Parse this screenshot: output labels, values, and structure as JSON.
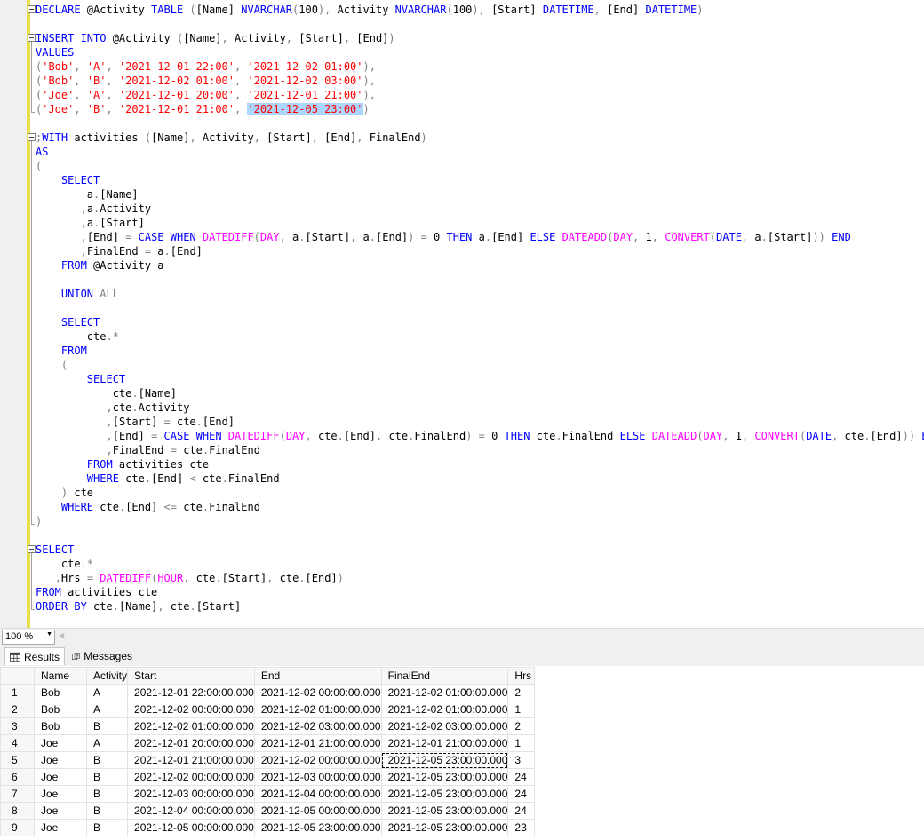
{
  "editor": {
    "lines": [
      [
        [
          "k",
          "DECLARE "
        ],
        [
          "t",
          "@Activity "
        ],
        [
          "k",
          "TABLE "
        ],
        [
          "g",
          "("
        ],
        [
          "t",
          "[Name] "
        ],
        [
          "k",
          "NVARCHAR"
        ],
        [
          "g",
          "("
        ],
        [
          "t",
          "100"
        ],
        [
          "g",
          "), "
        ],
        [
          "t",
          "Activity "
        ],
        [
          "k",
          "NVARCHAR"
        ],
        [
          "g",
          "("
        ],
        [
          "t",
          "100"
        ],
        [
          "g",
          "), "
        ],
        [
          "t",
          "[Start] "
        ],
        [
          "k",
          "DATETIME"
        ],
        [
          "g",
          ", "
        ],
        [
          "t",
          "[End] "
        ],
        [
          "k",
          "DATETIME"
        ],
        [
          "g",
          ")"
        ]
      ],
      [],
      [
        [
          "k",
          "INSERT INTO "
        ],
        [
          "t",
          "@Activity "
        ],
        [
          "g",
          "("
        ],
        [
          "t",
          "[Name]"
        ],
        [
          "g",
          ", "
        ],
        [
          "t",
          "Activity"
        ],
        [
          "g",
          ", "
        ],
        [
          "t",
          "[Start]"
        ],
        [
          "g",
          ", "
        ],
        [
          "t",
          "[End]"
        ],
        [
          "g",
          ")"
        ]
      ],
      [
        [
          "k",
          "VALUES"
        ]
      ],
      [
        [
          "g",
          "("
        ],
        [
          "s",
          "'Bob'"
        ],
        [
          "g",
          ", "
        ],
        [
          "s",
          "'A'"
        ],
        [
          "g",
          ", "
        ],
        [
          "s",
          "'2021-12-01 22:00'"
        ],
        [
          "g",
          ", "
        ],
        [
          "s",
          "'2021-12-02 01:00'"
        ],
        [
          "g",
          "),"
        ]
      ],
      [
        [
          "g",
          "("
        ],
        [
          "s",
          "'Bob'"
        ],
        [
          "g",
          ", "
        ],
        [
          "s",
          "'B'"
        ],
        [
          "g",
          ", "
        ],
        [
          "s",
          "'2021-12-02 01:00'"
        ],
        [
          "g",
          ", "
        ],
        [
          "s",
          "'2021-12-02 03:00'"
        ],
        [
          "g",
          "),"
        ]
      ],
      [
        [
          "g",
          "("
        ],
        [
          "s",
          "'Joe'"
        ],
        [
          "g",
          ", "
        ],
        [
          "s",
          "'A'"
        ],
        [
          "g",
          ", "
        ],
        [
          "s",
          "'2021-12-01 20:00'"
        ],
        [
          "g",
          ", "
        ],
        [
          "s",
          "'2021-12-01 21:00'"
        ],
        [
          "g",
          "),"
        ]
      ],
      [
        [
          "g",
          "("
        ],
        [
          "s",
          "'Joe'"
        ],
        [
          "g",
          ", "
        ],
        [
          "s",
          "'B'"
        ],
        [
          "g",
          ", "
        ],
        [
          "s",
          "'2021-12-01 21:00'"
        ],
        [
          "g",
          ", "
        ],
        [
          "sel",
          "'2021-12-05 23:00'"
        ],
        [
          "g",
          ")"
        ]
      ],
      [],
      [
        [
          "g",
          ";"
        ],
        [
          "k",
          "WITH "
        ],
        [
          "t",
          "activities "
        ],
        [
          "g",
          "("
        ],
        [
          "t",
          "[Name]"
        ],
        [
          "g",
          ", "
        ],
        [
          "t",
          "Activity"
        ],
        [
          "g",
          ", "
        ],
        [
          "t",
          "[Start]"
        ],
        [
          "g",
          ", "
        ],
        [
          "t",
          "[End]"
        ],
        [
          "g",
          ", "
        ],
        [
          "t",
          "FinalEnd"
        ],
        [
          "g",
          ")"
        ]
      ],
      [
        [
          "k",
          "AS"
        ]
      ],
      [
        [
          "g",
          "("
        ]
      ],
      [
        [
          "t",
          "    "
        ],
        [
          "k",
          "SELECT"
        ]
      ],
      [
        [
          "t",
          "        a"
        ],
        [
          "g",
          "."
        ],
        [
          "t",
          "[Name]"
        ]
      ],
      [
        [
          "t",
          "       "
        ],
        [
          "g",
          ","
        ],
        [
          "t",
          "a"
        ],
        [
          "g",
          "."
        ],
        [
          "t",
          "Activity"
        ]
      ],
      [
        [
          "t",
          "       "
        ],
        [
          "g",
          ","
        ],
        [
          "t",
          "a"
        ],
        [
          "g",
          "."
        ],
        [
          "t",
          "[Start]"
        ]
      ],
      [
        [
          "t",
          "       "
        ],
        [
          "g",
          ","
        ],
        [
          "t",
          "[End] "
        ],
        [
          "g",
          "= "
        ],
        [
          "k",
          "CASE WHEN "
        ],
        [
          "f",
          "DATEDIFF"
        ],
        [
          "g",
          "("
        ],
        [
          "f",
          "DAY"
        ],
        [
          "g",
          ", "
        ],
        [
          "t",
          "a"
        ],
        [
          "g",
          "."
        ],
        [
          "t",
          "[Start]"
        ],
        [
          "g",
          ", "
        ],
        [
          "t",
          "a"
        ],
        [
          "g",
          "."
        ],
        [
          "t",
          "[End]"
        ],
        [
          "g",
          ") = "
        ],
        [
          "t",
          "0 "
        ],
        [
          "k",
          "THEN "
        ],
        [
          "t",
          "a"
        ],
        [
          "g",
          "."
        ],
        [
          "t",
          "[End] "
        ],
        [
          "k",
          "ELSE "
        ],
        [
          "f",
          "DATEADD"
        ],
        [
          "g",
          "("
        ],
        [
          "f",
          "DAY"
        ],
        [
          "g",
          ", "
        ],
        [
          "t",
          "1"
        ],
        [
          "g",
          ", "
        ],
        [
          "f",
          "CONVERT"
        ],
        [
          "g",
          "("
        ],
        [
          "k",
          "DATE"
        ],
        [
          "g",
          ", "
        ],
        [
          "t",
          "a"
        ],
        [
          "g",
          "."
        ],
        [
          "t",
          "[Start]"
        ],
        [
          "g",
          "))"
        ],
        [
          "t",
          " "
        ],
        [
          "k",
          "END"
        ]
      ],
      [
        [
          "t",
          "       "
        ],
        [
          "g",
          ","
        ],
        [
          "t",
          "FinalEnd "
        ],
        [
          "g",
          "= "
        ],
        [
          "t",
          "a"
        ],
        [
          "g",
          "."
        ],
        [
          "t",
          "[End]"
        ]
      ],
      [
        [
          "t",
          "    "
        ],
        [
          "k",
          "FROM "
        ],
        [
          "t",
          "@Activity a"
        ]
      ],
      [],
      [
        [
          "t",
          "    "
        ],
        [
          "k",
          "UNION "
        ],
        [
          "g",
          "ALL"
        ]
      ],
      [],
      [
        [
          "t",
          "    "
        ],
        [
          "k",
          "SELECT"
        ]
      ],
      [
        [
          "t",
          "        cte"
        ],
        [
          "g",
          ".*"
        ]
      ],
      [
        [
          "t",
          "    "
        ],
        [
          "k",
          "FROM"
        ]
      ],
      [
        [
          "t",
          "    "
        ],
        [
          "g",
          "("
        ]
      ],
      [
        [
          "t",
          "        "
        ],
        [
          "k",
          "SELECT"
        ]
      ],
      [
        [
          "t",
          "            cte"
        ],
        [
          "g",
          "."
        ],
        [
          "t",
          "[Name]"
        ]
      ],
      [
        [
          "t",
          "           "
        ],
        [
          "g",
          ","
        ],
        [
          "t",
          "cte"
        ],
        [
          "g",
          "."
        ],
        [
          "t",
          "Activity"
        ]
      ],
      [
        [
          "t",
          "           "
        ],
        [
          "g",
          ","
        ],
        [
          "t",
          "[Start] "
        ],
        [
          "g",
          "= "
        ],
        [
          "t",
          "cte"
        ],
        [
          "g",
          "."
        ],
        [
          "t",
          "[End]"
        ]
      ],
      [
        [
          "t",
          "           "
        ],
        [
          "g",
          ","
        ],
        [
          "t",
          "[End] "
        ],
        [
          "g",
          "= "
        ],
        [
          "k",
          "CASE WHEN "
        ],
        [
          "f",
          "DATEDIFF"
        ],
        [
          "g",
          "("
        ],
        [
          "f",
          "DAY"
        ],
        [
          "g",
          ", "
        ],
        [
          "t",
          "cte"
        ],
        [
          "g",
          "."
        ],
        [
          "t",
          "[End]"
        ],
        [
          "g",
          ", "
        ],
        [
          "t",
          "cte"
        ],
        [
          "g",
          "."
        ],
        [
          "t",
          "FinalEnd"
        ],
        [
          "g",
          ") = "
        ],
        [
          "t",
          "0 "
        ],
        [
          "k",
          "THEN "
        ],
        [
          "t",
          "cte"
        ],
        [
          "g",
          "."
        ],
        [
          "t",
          "FinalEnd "
        ],
        [
          "k",
          "ELSE "
        ],
        [
          "f",
          "DATEADD"
        ],
        [
          "g",
          "("
        ],
        [
          "f",
          "DAY"
        ],
        [
          "g",
          ", "
        ],
        [
          "t",
          "1"
        ],
        [
          "g",
          ", "
        ],
        [
          "f",
          "CONVERT"
        ],
        [
          "g",
          "("
        ],
        [
          "k",
          "DATE"
        ],
        [
          "g",
          ", "
        ],
        [
          "t",
          "cte"
        ],
        [
          "g",
          "."
        ],
        [
          "t",
          "[End]"
        ],
        [
          "g",
          "))"
        ],
        [
          "t",
          " "
        ],
        [
          "k",
          "END"
        ]
      ],
      [
        [
          "t",
          "           "
        ],
        [
          "g",
          ","
        ],
        [
          "t",
          "FinalEnd "
        ],
        [
          "g",
          "= "
        ],
        [
          "t",
          "cte"
        ],
        [
          "g",
          "."
        ],
        [
          "t",
          "FinalEnd"
        ]
      ],
      [
        [
          "t",
          "        "
        ],
        [
          "k",
          "FROM "
        ],
        [
          "t",
          "activities cte"
        ]
      ],
      [
        [
          "t",
          "        "
        ],
        [
          "k",
          "WHERE "
        ],
        [
          "t",
          "cte"
        ],
        [
          "g",
          "."
        ],
        [
          "t",
          "[End] "
        ],
        [
          "g",
          "< "
        ],
        [
          "t",
          "cte"
        ],
        [
          "g",
          "."
        ],
        [
          "t",
          "FinalEnd"
        ]
      ],
      [
        [
          "t",
          "    "
        ],
        [
          "g",
          ") "
        ],
        [
          "t",
          "cte"
        ]
      ],
      [
        [
          "t",
          "    "
        ],
        [
          "k",
          "WHERE "
        ],
        [
          "t",
          "cte"
        ],
        [
          "g",
          "."
        ],
        [
          "t",
          "[End] "
        ],
        [
          "g",
          "<= "
        ],
        [
          "t",
          "cte"
        ],
        [
          "g",
          "."
        ],
        [
          "t",
          "FinalEnd"
        ]
      ],
      [
        [
          "g",
          ")"
        ]
      ],
      [],
      [
        [
          "k",
          "SELECT"
        ]
      ],
      [
        [
          "t",
          "    cte"
        ],
        [
          "g",
          ".*"
        ]
      ],
      [
        [
          "t",
          "   "
        ],
        [
          "g",
          ","
        ],
        [
          "t",
          "Hrs "
        ],
        [
          "g",
          "= "
        ],
        [
          "f",
          "DATEDIFF"
        ],
        [
          "g",
          "("
        ],
        [
          "f",
          "HOUR"
        ],
        [
          "g",
          ", "
        ],
        [
          "t",
          "cte"
        ],
        [
          "g",
          "."
        ],
        [
          "t",
          "[Start]"
        ],
        [
          "g",
          ", "
        ],
        [
          "t",
          "cte"
        ],
        [
          "g",
          "."
        ],
        [
          "t",
          "[End]"
        ],
        [
          "g",
          ")"
        ]
      ],
      [
        [
          "k",
          "FROM "
        ],
        [
          "t",
          "activities cte"
        ]
      ],
      [
        [
          "k",
          "ORDER BY "
        ],
        [
          "t",
          "cte"
        ],
        [
          "g",
          "."
        ],
        [
          "t",
          "[Name]"
        ],
        [
          "g",
          ", "
        ],
        [
          "t",
          "cte"
        ],
        [
          "g",
          "."
        ],
        [
          "t",
          "[Start]"
        ]
      ]
    ]
  },
  "status": {
    "zoom": "100 %"
  },
  "tabs": {
    "results": "Results",
    "messages": "Messages"
  },
  "grid": {
    "columns": [
      "Name",
      "Activity",
      "Start",
      "End",
      "FinalEnd",
      "Hrs"
    ],
    "rows": [
      [
        "1",
        "Bob",
        "A",
        "2021-12-01 22:00:00.000",
        "2021-12-02 00:00:00.000",
        "2021-12-02 01:00:00.000",
        "2"
      ],
      [
        "2",
        "Bob",
        "A",
        "2021-12-02 00:00:00.000",
        "2021-12-02 01:00:00.000",
        "2021-12-02 01:00:00.000",
        "1"
      ],
      [
        "3",
        "Bob",
        "B",
        "2021-12-02 01:00:00.000",
        "2021-12-02 03:00:00.000",
        "2021-12-02 03:00:00.000",
        "2"
      ],
      [
        "4",
        "Joe",
        "A",
        "2021-12-01 20:00:00.000",
        "2021-12-01 21:00:00.000",
        "2021-12-01 21:00:00.000",
        "1"
      ],
      [
        "5",
        "Joe",
        "B",
        "2021-12-01 21:00:00.000",
        "2021-12-02 00:00:00.000",
        "2021-12-05 23:00:00.000",
        "3"
      ],
      [
        "6",
        "Joe",
        "B",
        "2021-12-02 00:00:00.000",
        "2021-12-03 00:00:00.000",
        "2021-12-05 23:00:00.000",
        "24"
      ],
      [
        "7",
        "Joe",
        "B",
        "2021-12-03 00:00:00.000",
        "2021-12-04 00:00:00.000",
        "2021-12-05 23:00:00.000",
        "24"
      ],
      [
        "8",
        "Joe",
        "B",
        "2021-12-04 00:00:00.000",
        "2021-12-05 00:00:00.000",
        "2021-12-05 23:00:00.000",
        "24"
      ],
      [
        "9",
        "Joe",
        "B",
        "2021-12-05 00:00:00.000",
        "2021-12-05 23:00:00.000",
        "2021-12-05 23:00:00.000",
        "23"
      ]
    ]
  },
  "colors": {
    "keyword": "#0000ff",
    "string": "#ff0000",
    "function": "#ff00ff",
    "operator": "#808080",
    "selection": "#add6ff"
  },
  "icons": {
    "results_tab": "grid-icon",
    "messages_tab": "messages-icon"
  }
}
